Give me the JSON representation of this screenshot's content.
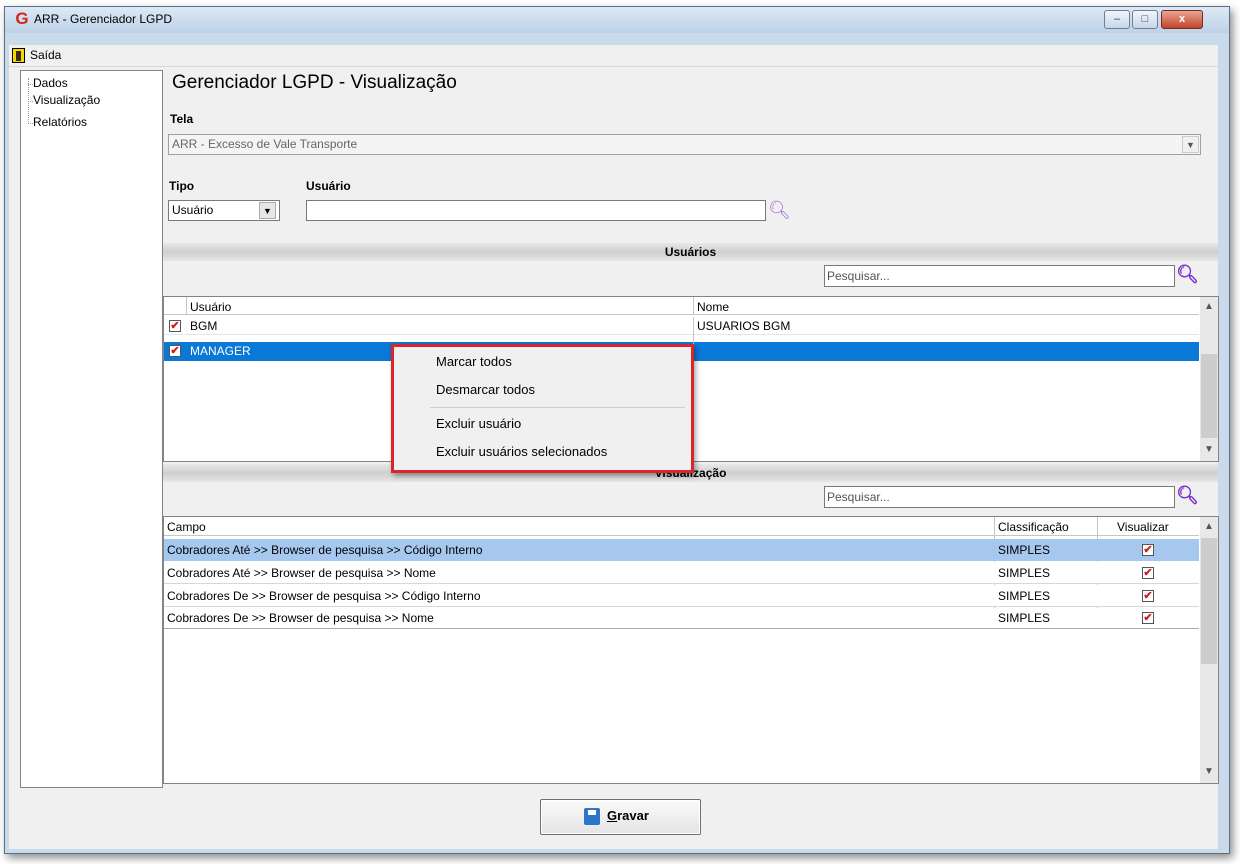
{
  "window": {
    "title": "ARR - Gerenciador LGPD",
    "app_icon": "G",
    "close_glyph": "x",
    "min_glyph": "–",
    "max_glyph": "□"
  },
  "menu": {
    "exit_label": "Saída"
  },
  "tree": {
    "items": [
      "Dados",
      "Visualização",
      "Relatórios"
    ]
  },
  "page": {
    "title": "Gerenciador LGPD - Visualização"
  },
  "filters": {
    "tela_label": "Tela",
    "tela_value": "ARR - Excesso de Vale Transporte",
    "tipo_label": "Tipo",
    "tipo_value": "Usuário",
    "usuario_label": "Usuário",
    "usuario_value": ""
  },
  "usuarios": {
    "section_title": "Usuários",
    "search_placeholder": "Pesquisar...",
    "columns": [
      "Usuário",
      "Nome"
    ],
    "rows": [
      {
        "checked": true,
        "usuario": "BGM",
        "nome": "USUARIOS BGM",
        "selected": false
      },
      {
        "checked": true,
        "usuario": "MANAGER",
        "nome": "",
        "selected": true
      }
    ]
  },
  "visualizacao": {
    "section_title": "Visualização",
    "search_placeholder": "Pesquisar...",
    "columns": [
      "Campo",
      "Classificação",
      "Visualizar"
    ],
    "rows": [
      {
        "campo": "Cobradores Até >> Browser de pesquisa >> Código Interno",
        "classificacao": "SIMPLES",
        "visualizar": true,
        "selected": true
      },
      {
        "campo": "Cobradores Até >> Browser de pesquisa >> Nome",
        "classificacao": "SIMPLES",
        "visualizar": true,
        "selected": false
      },
      {
        "campo": "Cobradores De >> Browser de pesquisa >> Código Interno",
        "classificacao": "SIMPLES",
        "visualizar": true,
        "selected": false
      },
      {
        "campo": "Cobradores De >> Browser de pesquisa >> Nome",
        "classificacao": "SIMPLES",
        "visualizar": true,
        "selected": false
      }
    ]
  },
  "context_menu": {
    "items": [
      "Marcar todos",
      "Desmarcar todos",
      "Excluir usuário",
      "Excluir usuários selecionados"
    ],
    "highlight_color": "#d9262b"
  },
  "footer": {
    "save_label": "Gravar"
  },
  "colors": {
    "selection": "#0a78d7",
    "selection_light": "#a6c8ef",
    "search_icon": "#7a2ed0"
  }
}
